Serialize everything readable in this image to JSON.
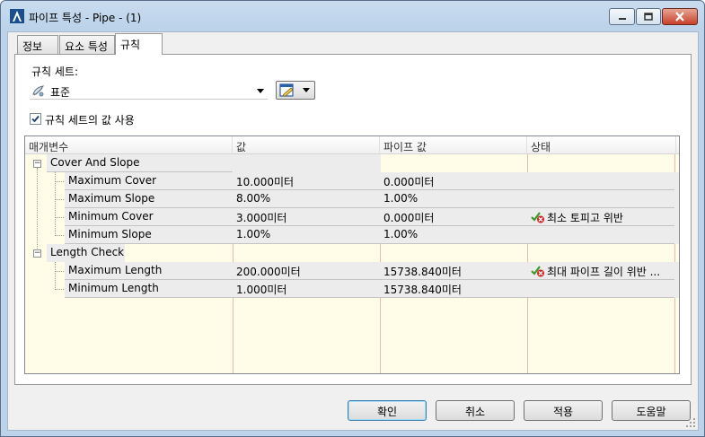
{
  "window": {
    "title": "파이프 특성 - Pipe - (1)"
  },
  "tabs": [
    {
      "label": "정보"
    },
    {
      "label": "요소 특성"
    },
    {
      "label": "규칙"
    }
  ],
  "ruleset": {
    "label": "규칙 세트:",
    "selected": "표준",
    "use_values_label": "규칙 세트의 값 사용",
    "use_values_checked": true
  },
  "grid": {
    "columns": [
      "매개변수",
      "값",
      "파이프 값",
      "상태"
    ],
    "groups": [
      {
        "name": "Cover And Slope",
        "rows": [
          {
            "param": "Maximum Cover",
            "value": "10.000미터",
            "pipe_value": "0.000미터",
            "status": ""
          },
          {
            "param": "Maximum Slope",
            "value": "8.00%",
            "pipe_value": "1.00%",
            "status": ""
          },
          {
            "param": "Minimum Cover",
            "value": "3.000미터",
            "pipe_value": "0.000미터",
            "status": "최소 토피고 위반"
          },
          {
            "param": "Minimum Slope",
            "value": "1.00%",
            "pipe_value": "1.00%",
            "status": ""
          }
        ]
      },
      {
        "name": "Length Check",
        "rows": [
          {
            "param": "Maximum Length",
            "value": "200.000미터",
            "pipe_value": "15738.840미터",
            "status": "최대 파이프 길이 위반 ..."
          },
          {
            "param": "Minimum Length",
            "value": "1.000미터",
            "pipe_value": "15738.840미터",
            "status": ""
          }
        ]
      }
    ]
  },
  "buttons": {
    "ok": "확인",
    "cancel": "취소",
    "apply": "적용",
    "help": "도움말"
  },
  "colors": {
    "grid_background": "#fffde8",
    "violation_check": "#3a9a2c",
    "violation_x": "#d42020"
  }
}
